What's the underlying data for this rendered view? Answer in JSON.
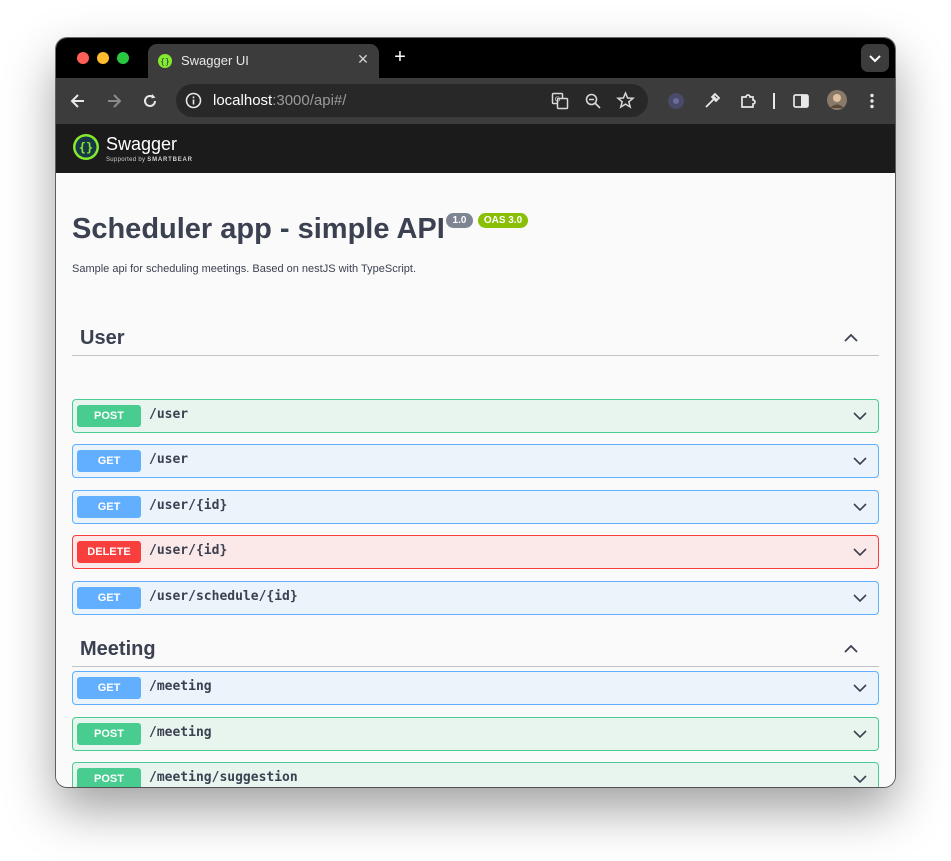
{
  "browser": {
    "tab_title": "Swagger UI",
    "new_tab_label": "+",
    "url_host": "localhost",
    "url_rest": ":3000/api#/"
  },
  "swagger_header": {
    "brand": "Swagger",
    "sub_prefix": "Supported by",
    "sub_brand": "SMARTBEAR",
    "logo_color": "#85ea2d"
  },
  "info": {
    "title": "Scheduler app - simple API",
    "version_badge": "1.0",
    "oas_badge": "OAS 3.0",
    "description": "Sample api for scheduling meetings. Based on nestJS with TypeScript."
  },
  "tags": [
    {
      "name": "User",
      "operations": [
        {
          "method": "POST",
          "path": "/user"
        },
        {
          "method": "GET",
          "path": "/user"
        },
        {
          "method": "GET",
          "path": "/user/{id}"
        },
        {
          "method": "DELETE",
          "path": "/user/{id}"
        },
        {
          "method": "GET",
          "path": "/user/schedule/{id}"
        }
      ]
    },
    {
      "name": "Meeting",
      "operations": [
        {
          "method": "GET",
          "path": "/meeting"
        },
        {
          "method": "POST",
          "path": "/meeting"
        },
        {
          "method": "POST",
          "path": "/meeting/suggestion"
        }
      ]
    }
  ],
  "colors": {
    "post": "#49cc90",
    "get": "#61affe",
    "delete": "#f93e3e"
  }
}
